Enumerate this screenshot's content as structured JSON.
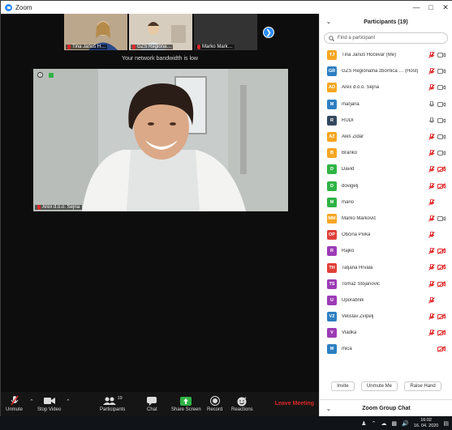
{
  "window": {
    "title": "Zoom"
  },
  "strip": {
    "thumbs": [
      {
        "name": "Tina Januš H…"
      },
      {
        "name": "GZS Regiona…"
      },
      {
        "name": "Marko Mark…"
      }
    ]
  },
  "bandwidth_notice": "Your network bandwidth is low",
  "main_video": {
    "name": "Arex d.o.o. Sejna"
  },
  "toolbar": {
    "unmute": "Unmute",
    "stop_video": "Stop Video",
    "participants": "Participants",
    "participants_count": "19",
    "chat": "Chat",
    "share_screen": "Share Screen",
    "record": "Record",
    "reactions": "Reactions",
    "leave": "Leave Meeting"
  },
  "panel": {
    "title": "Participants (19)",
    "search_placeholder": "Find a participant",
    "participants": [
      {
        "initials": "TJ",
        "name": "Tina Januš Hočevar (Me)",
        "color": "#f5a623",
        "mic": "muted",
        "cam": "on"
      },
      {
        "initials": "GR",
        "name": "GZS Regionalna zbornica … (Host)",
        "color": "#2d7fc1",
        "mic": "muted",
        "cam": "on"
      },
      {
        "initials": "AD",
        "name": "Arex d.o.o. Sejna",
        "color": "#f5a623",
        "mic": "muted",
        "cam": "on"
      },
      {
        "initials": "M",
        "name": "marjana",
        "color": "#2d7fc1",
        "mic": "on",
        "cam": "on"
      },
      {
        "initials": "R",
        "name": "RUDI",
        "color": "#34495e",
        "mic": "on",
        "cam": "on"
      },
      {
        "initials": "AZ",
        "name": "Aleš Zidar",
        "color": "#f5a623",
        "mic": "muted",
        "cam": "on"
      },
      {
        "initials": "B",
        "name": "Branko",
        "color": "#f5a623",
        "mic": "muted",
        "cam": "on"
      },
      {
        "initials": "D",
        "name": "David",
        "color": "#2fb344",
        "mic": "muted",
        "cam": "off"
      },
      {
        "initials": "D",
        "name": "dovigelj",
        "color": "#2fb344",
        "mic": "muted",
        "cam": "off"
      },
      {
        "initials": "M",
        "name": "mario",
        "color": "#2fb344",
        "mic": "muted",
        "cam": "none"
      },
      {
        "initials": "MM",
        "name": "Marko Markovič",
        "color": "#f5a623",
        "mic": "muted",
        "cam": "on"
      },
      {
        "initials": "OP",
        "name": "Občina Pivka",
        "color": "#e0403a",
        "mic": "muted",
        "cam": "none"
      },
      {
        "initials": "R",
        "name": "Rajko",
        "color": "#9b3bb5",
        "mic": "muted",
        "cam": "off"
      },
      {
        "initials": "TH",
        "name": "Tatjana Hrvala",
        "color": "#e0403a",
        "mic": "muted",
        "cam": "off"
      },
      {
        "initials": "TS",
        "name": "Tomaz Stojanovic",
        "color": "#9b3bb5",
        "mic": "muted",
        "cam": "off"
      },
      {
        "initials": "U",
        "name": "Uporabnik",
        "color": "#9b3bb5",
        "mic": "muted",
        "cam": "none"
      },
      {
        "initials": "VZ",
        "name": "Velislav Zvipelj",
        "color": "#2d7fc1",
        "mic": "muted",
        "cam": "off"
      },
      {
        "initials": "V",
        "name": "Vladka",
        "color": "#9b3bb5",
        "mic": "muted",
        "cam": "off"
      },
      {
        "initials": "M",
        "name": "mica",
        "color": "#2d7fc1",
        "mic": "none",
        "cam": "off"
      }
    ],
    "buttons": {
      "invite": "Invite",
      "unmute_me": "Unmute Me",
      "raise_hand": "Raise Hand"
    },
    "chat_title": "Zoom Group Chat"
  },
  "taskbar": {
    "time": "16:02",
    "date": "16. 04. 2020"
  }
}
